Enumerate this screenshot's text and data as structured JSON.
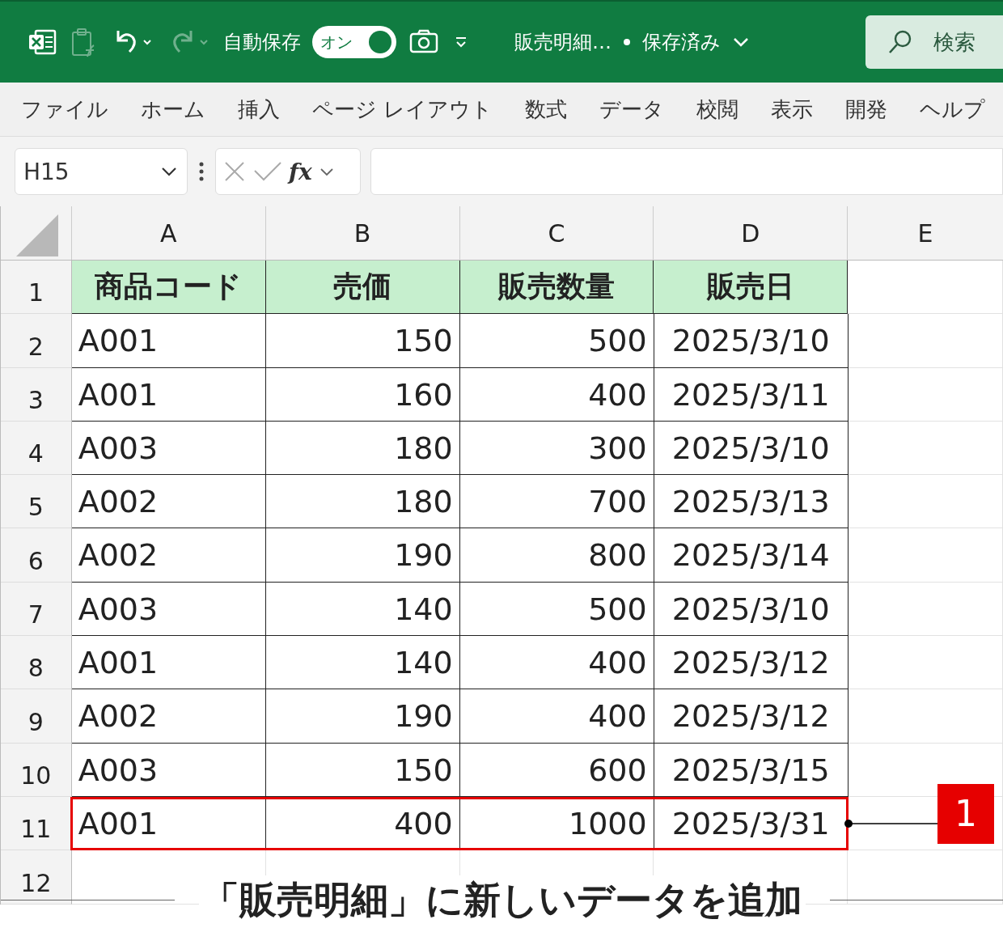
{
  "title_bar": {
    "autosave_label": "自動保存",
    "autosave_toggle": {
      "label": "オン",
      "on": true
    },
    "file_name": "販売明細…",
    "save_status": "保存済み",
    "search": {
      "placeholder": "検索"
    }
  },
  "ribbon_tabs": [
    "ファイル",
    "ホーム",
    "挿入",
    "ページ レイアウト",
    "数式",
    "データ",
    "校閲",
    "表示",
    "開発",
    "ヘルプ"
  ],
  "formula_bar": {
    "name_box": "H15",
    "function_label": "fx"
  },
  "sheet": {
    "column_headers": [
      "A",
      "B",
      "C",
      "D",
      "E"
    ],
    "header_row": {
      "row_number": "1",
      "cells": [
        "商品コード",
        "売価",
        "販売数量",
        "販売日"
      ]
    },
    "rows": [
      {
        "row_number": "2",
        "cells": [
          "A001",
          "150",
          "500",
          "2025/3/10"
        ],
        "highlighted": false
      },
      {
        "row_number": "3",
        "cells": [
          "A001",
          "160",
          "400",
          "2025/3/11"
        ],
        "highlighted": false
      },
      {
        "row_number": "4",
        "cells": [
          "A003",
          "180",
          "300",
          "2025/3/10"
        ],
        "highlighted": false
      },
      {
        "row_number": "5",
        "cells": [
          "A002",
          "180",
          "700",
          "2025/3/13"
        ],
        "highlighted": false
      },
      {
        "row_number": "6",
        "cells": [
          "A002",
          "190",
          "800",
          "2025/3/14"
        ],
        "highlighted": false
      },
      {
        "row_number": "7",
        "cells": [
          "A003",
          "140",
          "500",
          "2025/3/10"
        ],
        "highlighted": false
      },
      {
        "row_number": "8",
        "cells": [
          "A001",
          "140",
          "400",
          "2025/3/12"
        ],
        "highlighted": false
      },
      {
        "row_number": "9",
        "cells": [
          "A002",
          "190",
          "400",
          "2025/3/12"
        ],
        "highlighted": false
      },
      {
        "row_number": "10",
        "cells": [
          "A003",
          "150",
          "600",
          "2025/3/15"
        ],
        "highlighted": false
      },
      {
        "row_number": "11",
        "cells": [
          "A001",
          "400",
          "1000",
          "2025/3/31"
        ],
        "highlighted": true,
        "callout": "1"
      }
    ],
    "empty_rows": [
      "12"
    ]
  },
  "caption": "「販売明細」に新しいデータを追加"
}
